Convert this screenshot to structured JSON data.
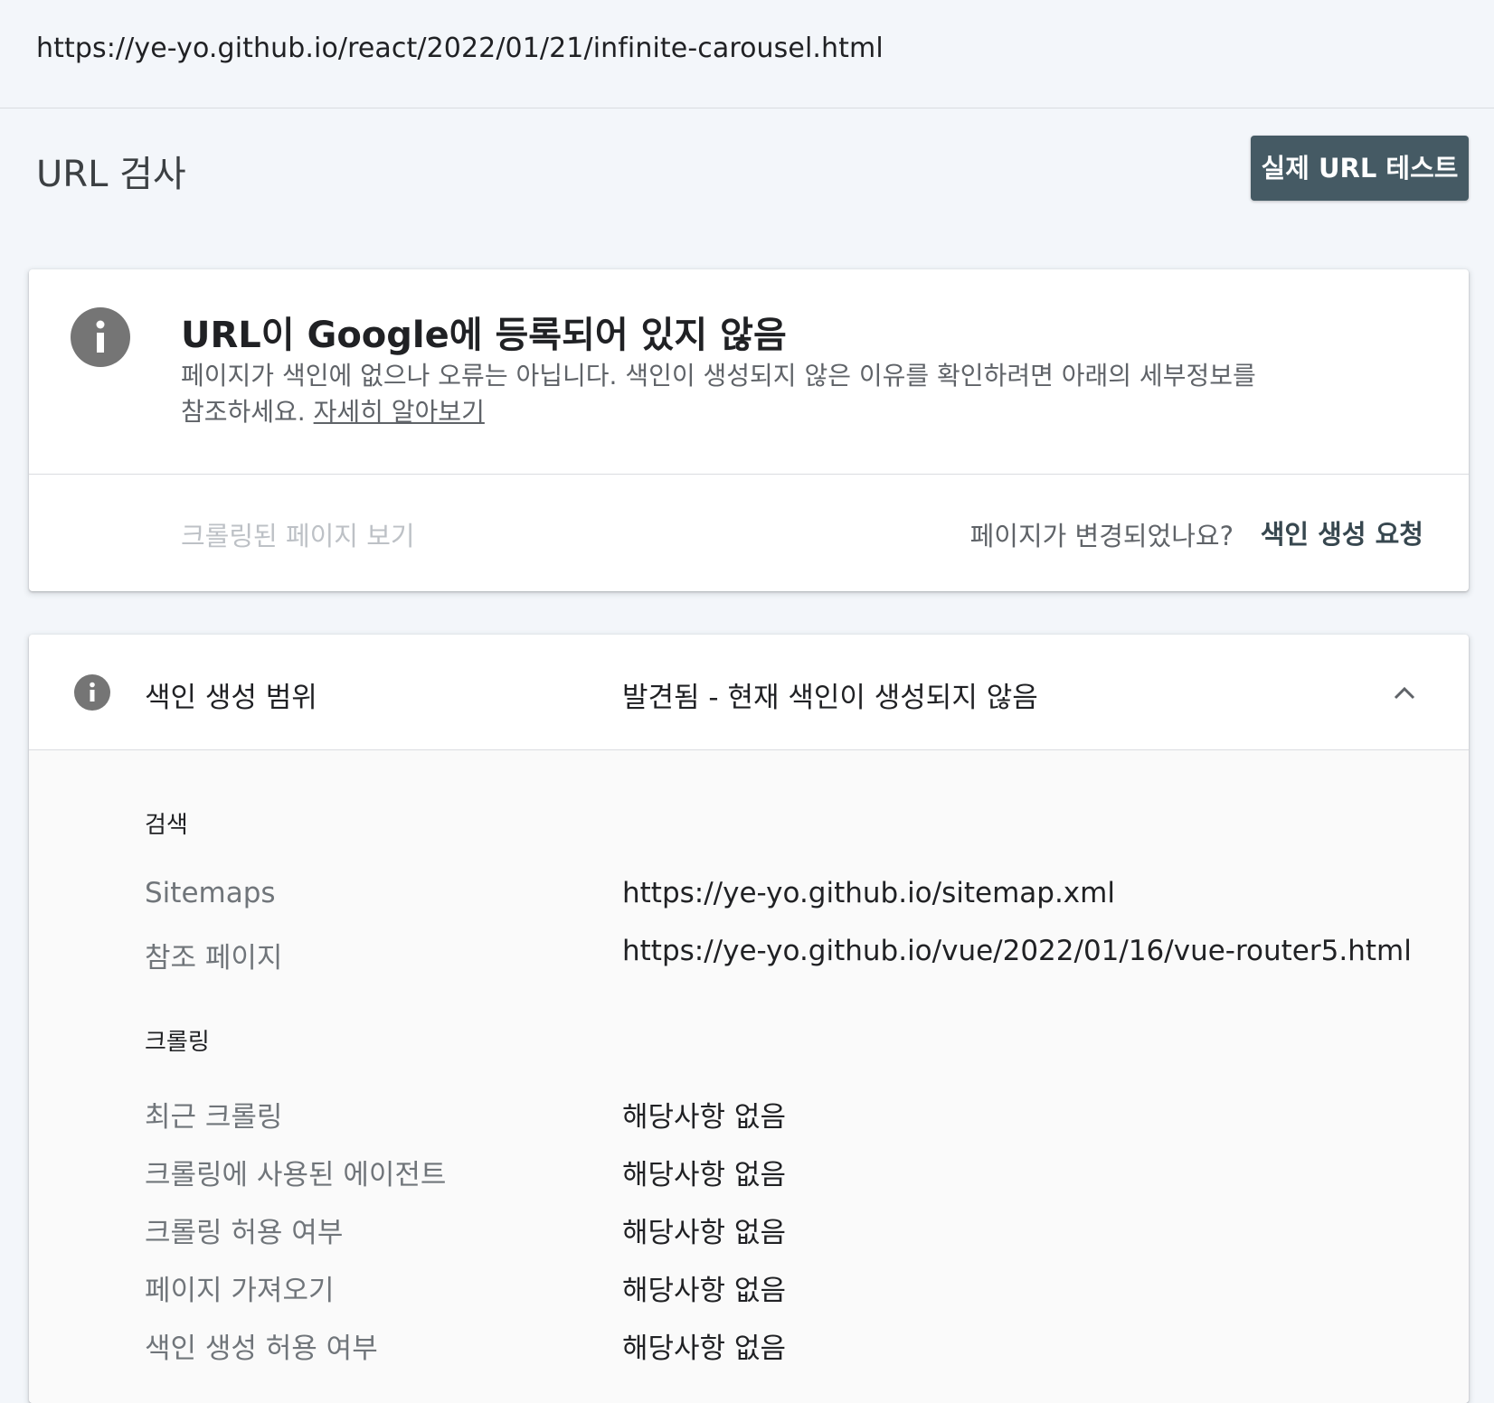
{
  "topbar": {
    "url": "https://ye-yo.github.io/react/2022/01/21/infinite-carousel.html"
  },
  "header": {
    "title": "URL 검사",
    "live_test_label": "실제 URL 테스트"
  },
  "status": {
    "title": "URL이 Google에 등록되어 있지 않음",
    "description": "페이지가 색인에 없으나 오류는 아닙니다. 색인이 생성되지 않은 이유를 확인하려면 아래의 세부정보를 참조하세요.",
    "learn_more": "자세히 알아보기",
    "crawled_page": "크롤링된 페이지 보기",
    "changed_question": "페이지가 변경되었나요?",
    "request_indexing": "색인 생성 요청"
  },
  "coverage": {
    "label": "색인 생성 범위",
    "value": "발견됨 - 현재 색인이 생성되지 않음",
    "sections": {
      "search": {
        "heading": "검색",
        "rows": [
          {
            "label": "Sitemaps",
            "value": "https://ye-yo.github.io/sitemap.xml"
          },
          {
            "label": "참조 페이지",
            "value": "https://ye-yo.github.io/vue/2022/01/16/vue-router5.html"
          }
        ]
      },
      "crawl": {
        "heading": "크롤링",
        "rows": [
          {
            "label": "최근 크롤링",
            "value": "해당사항 없음"
          },
          {
            "label": "크롤링에 사용된 에이전트",
            "value": "해당사항 없음"
          },
          {
            "label": "크롤링 허용 여부",
            "value": "해당사항 없음"
          },
          {
            "label": "페이지 가져오기",
            "value": "해당사항 없음"
          },
          {
            "label": "색인 생성 허용 여부",
            "value": "해당사항 없음"
          }
        ]
      }
    }
  },
  "colors": {
    "background": "#f3f6fa",
    "button": "#455a64",
    "info_icon": "#757575",
    "link_accent": "#37474f"
  },
  "icons": [
    "info-icon",
    "info-icon-small",
    "chevron-up-icon"
  ]
}
